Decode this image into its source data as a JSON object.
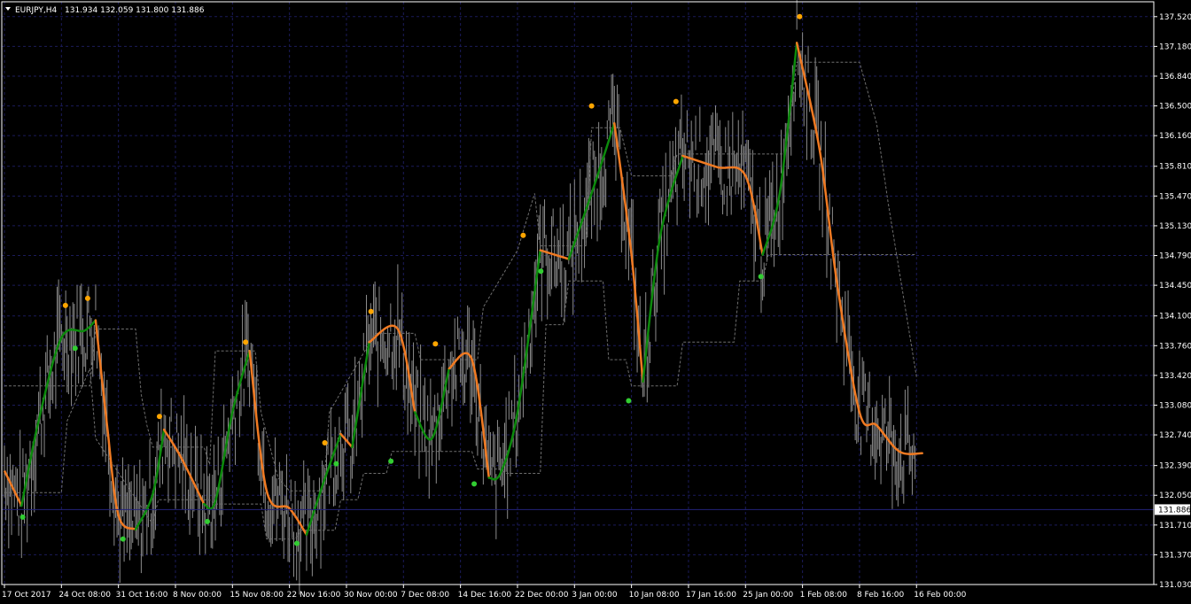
{
  "header": {
    "symbol_timeframe": "EURJPY,H4",
    "ohlc": "131.934 132.059 131.800 131.886"
  },
  "colors": {
    "background": "#000000",
    "grid": "#1b1b5a",
    "axis": "#ffffff",
    "price_bars": "#8c8c8c",
    "trend_up": "#0c8a0c",
    "trend_down": "#f07a22",
    "swing_high_dot": "#ffa500",
    "swing_low_dot": "#32cd32",
    "bands": "#6e6e6e",
    "current_price_line": "#22227a"
  },
  "chart_data": {
    "type": "line",
    "title": "EURJPY,H4  131.934 132.059 131.800 131.886",
    "xlabel": "",
    "ylabel": "",
    "grid": true,
    "ylim": [
      131.03,
      137.69
    ],
    "y_ticks": [
      "137.520",
      "137.180",
      "136.840",
      "136.500",
      "136.160",
      "135.810",
      "135.470",
      "135.130",
      "134.790",
      "134.450",
      "134.100",
      "133.760",
      "133.420",
      "133.080",
      "132.740",
      "132.390",
      "132.050",
      "131.710",
      "131.370",
      "131.030"
    ],
    "current_price": "131.886",
    "x_ticks": [
      "17 Oct 2017",
      "24 Oct 08:00",
      "31 Oct 16:00",
      "8 Nov 00:00",
      "15 Nov 08:00",
      "22 Nov 16:00",
      "30 Nov 00:00",
      "7 Dec 08:00",
      "14 Dec 16:00",
      "22 Dec 00:00",
      "3 Jan 00:00",
      "10 Jan 08:00",
      "17 Jan 16:00",
      "25 Jan 00:00",
      "1 Feb 08:00",
      "8 Feb 16:00",
      "16 Feb 00:00"
    ],
    "x_range": [
      0,
      16.4
    ],
    "series": [
      {
        "role": "trend-line",
        "x": [
          0.0,
          0.3,
          0.6,
          1.0,
          1.4,
          1.6,
          1.8,
          2.0,
          2.3,
          2.6,
          2.8,
          3.1,
          3.5,
          3.7,
          4.0,
          4.3,
          4.6,
          5.0,
          5.3,
          5.6,
          5.9,
          6.1,
          6.4,
          6.9,
          7.2,
          7.5,
          7.8,
          8.2,
          8.5,
          8.7,
          9.0,
          9.4,
          9.9,
          10.3,
          10.7,
          11.0,
          11.2,
          11.5,
          11.9,
          12.5,
          13.0,
          13.3,
          13.6,
          13.9,
          14.3,
          14.6,
          15.0,
          15.3,
          15.7,
          16.1
        ],
        "y": [
          132.33,
          131.93,
          132.9,
          133.85,
          133.93,
          134.05,
          132.85,
          131.82,
          131.66,
          132.06,
          132.8,
          132.48,
          131.95,
          131.98,
          133.0,
          133.7,
          132.1,
          131.9,
          131.6,
          132.2,
          132.75,
          132.6,
          133.8,
          133.95,
          133.0,
          132.7,
          133.5,
          133.6,
          132.25,
          132.3,
          133.0,
          134.85,
          134.75,
          135.5,
          136.3,
          134.8,
          133.35,
          135.0,
          135.93,
          135.8,
          135.7,
          134.8,
          135.5,
          137.22,
          136.0,
          134.5,
          133.0,
          132.85,
          132.55,
          132.53
        ],
        "segments": [
          {
            "direction": "up",
            "from": 0.3,
            "to": 1.6
          },
          {
            "direction": "down",
            "from": 1.6,
            "to": 2.3
          },
          {
            "direction": "up",
            "from": 2.3,
            "to": 2.8
          },
          {
            "direction": "down",
            "from": 2.8,
            "to": 3.5
          },
          {
            "direction": "up",
            "from": 3.5,
            "to": 4.3
          },
          {
            "direction": "down",
            "from": 4.3,
            "to": 5.3
          },
          {
            "direction": "up",
            "from": 5.3,
            "to": 5.9
          },
          {
            "direction": "down",
            "from": 5.9,
            "to": 6.1
          },
          {
            "direction": "up",
            "from": 6.1,
            "to": 6.4
          },
          {
            "direction": "down",
            "from": 6.4,
            "to": 7.2
          },
          {
            "direction": "up",
            "from": 7.2,
            "to": 7.8
          },
          {
            "direction": "down",
            "from": 7.8,
            "to": 8.5
          },
          {
            "direction": "up",
            "from": 8.5,
            "to": 9.4
          },
          {
            "direction": "down",
            "from": 9.4,
            "to": 9.9
          },
          {
            "direction": "up",
            "from": 9.9,
            "to": 10.7
          },
          {
            "direction": "down",
            "from": 10.7,
            "to": 11.2
          },
          {
            "direction": "up",
            "from": 11.2,
            "to": 11.9
          },
          {
            "direction": "down",
            "from": 11.9,
            "to": 13.3
          },
          {
            "direction": "up",
            "from": 13.3,
            "to": 13.9
          },
          {
            "direction": "down",
            "from": 13.9,
            "to": 16.1
          }
        ]
      },
      {
        "role": "swing-high-dots",
        "points": [
          [
            1.07,
            134.22
          ],
          [
            1.46,
            134.3
          ],
          [
            2.72,
            132.95
          ],
          [
            4.23,
            133.8
          ],
          [
            5.62,
            132.65
          ],
          [
            6.43,
            134.15
          ],
          [
            7.56,
            133.78
          ],
          [
            9.1,
            135.02
          ],
          [
            10.3,
            136.5
          ],
          [
            11.78,
            136.55
          ],
          [
            13.95,
            137.52
          ]
        ]
      },
      {
        "role": "swing-low-dots",
        "points": [
          [
            0.32,
            131.8
          ],
          [
            1.24,
            133.73
          ],
          [
            2.08,
            131.55
          ],
          [
            3.56,
            131.75
          ],
          [
            5.13,
            131.5
          ],
          [
            5.82,
            132.41
          ],
          [
            6.78,
            132.44
          ],
          [
            8.24,
            132.18
          ],
          [
            9.41,
            134.61
          ],
          [
            10.95,
            133.13
          ],
          [
            13.27,
            134.55
          ]
        ]
      },
      {
        "role": "upper-band",
        "x": [
          0,
          1.5,
          1.6,
          2.3,
          2.4,
          2.5,
          2.6,
          3.5,
          3.6,
          3.7,
          4.4,
          4.5,
          4.8,
          5.0,
          5.6,
          5.7,
          6.5,
          7.2,
          7.3,
          8.0,
          8.3,
          8.4,
          9.0,
          9.3,
          9.4,
          10.2,
          10.3,
          10.8,
          11.0,
          11.7,
          11.8,
          12.8,
          13.7,
          13.9,
          14.0,
          15.0,
          15.3,
          15.5,
          16.0
        ],
        "y": [
          133.3,
          133.3,
          133.95,
          133.95,
          133.2,
          132.85,
          132.6,
          132.6,
          132.4,
          133.7,
          133.7,
          133.0,
          132.25,
          132.1,
          132.1,
          133.0,
          133.9,
          133.9,
          133.6,
          133.6,
          133.6,
          134.2,
          134.85,
          135.5,
          134.9,
          134.9,
          136.25,
          136.25,
          135.7,
          135.7,
          135.95,
          135.95,
          135.95,
          137.0,
          137.0,
          137.0,
          136.3,
          135.4,
          133.4
        ]
      },
      {
        "role": "lower-band",
        "x": [
          0,
          1.0,
          1.1,
          1.5,
          1.6,
          2.6,
          2.7,
          3.6,
          3.7,
          4.5,
          4.6,
          5.1,
          5.2,
          5.8,
          5.9,
          6.2,
          6.3,
          6.7,
          6.8,
          8.2,
          8.3,
          8.7,
          8.8,
          9.4,
          9.5,
          9.8,
          9.9,
          10.5,
          10.6,
          10.9,
          11.0,
          11.8,
          11.9,
          12.8,
          12.9,
          13.3,
          13.4,
          14.0,
          14.1,
          16.0
        ],
        "y": [
          132.08,
          132.08,
          132.9,
          133.5,
          132.7,
          131.72,
          132.0,
          132.0,
          131.95,
          131.95,
          131.55,
          131.55,
          131.65,
          131.65,
          132.0,
          132.0,
          132.3,
          132.3,
          132.55,
          132.55,
          132.35,
          132.35,
          132.3,
          132.3,
          134.0,
          134.0,
          134.5,
          134.5,
          133.6,
          133.6,
          133.3,
          133.3,
          133.8,
          133.8,
          134.5,
          134.5,
          134.8,
          134.8,
          134.8,
          134.8
        ]
      }
    ]
  }
}
